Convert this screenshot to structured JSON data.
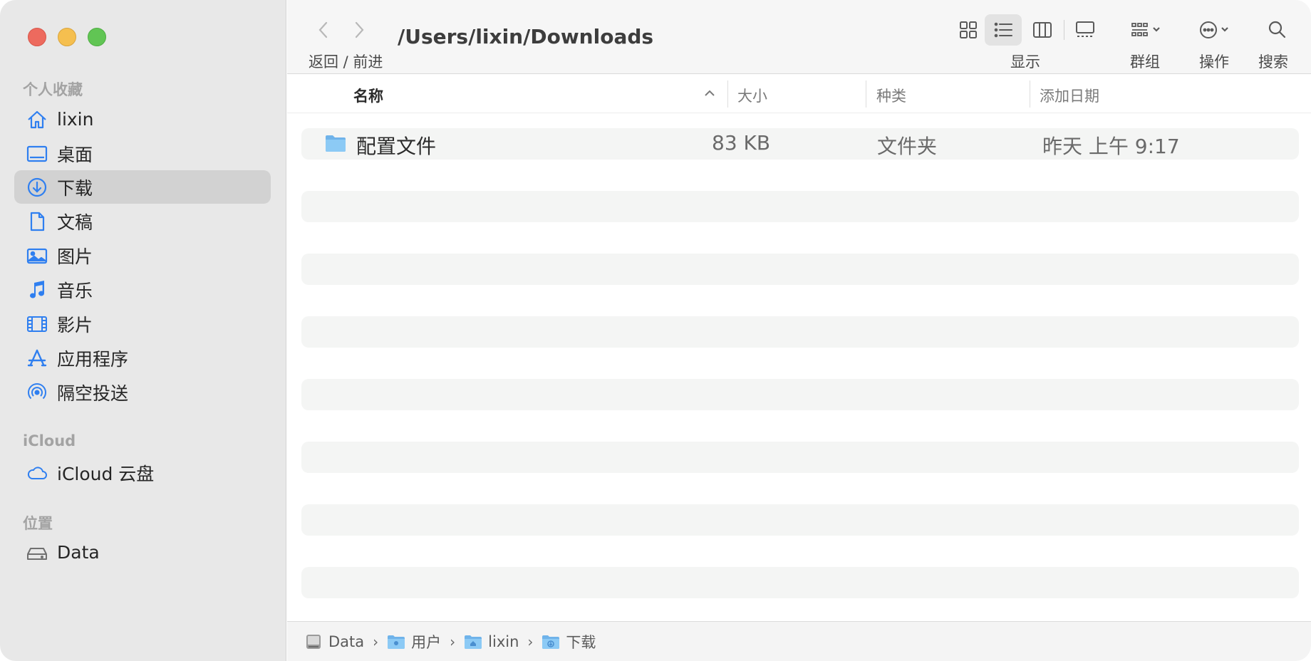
{
  "sidebar": {
    "favorites_title": "个人收藏",
    "favorites": [
      {
        "label": "lixin",
        "icon": "home-icon"
      },
      {
        "label": "桌面",
        "icon": "desktop-icon"
      },
      {
        "label": "下载",
        "icon": "download-icon",
        "selected": true
      },
      {
        "label": "文稿",
        "icon": "document-icon"
      },
      {
        "label": "图片",
        "icon": "photo-icon"
      },
      {
        "label": "音乐",
        "icon": "music-icon"
      },
      {
        "label": "影片",
        "icon": "film-icon"
      },
      {
        "label": "应用程序",
        "icon": "app-store-icon"
      },
      {
        "label": "隔空投送",
        "icon": "airdrop-icon"
      }
    ],
    "icloud_title": "iCloud",
    "icloud": [
      {
        "label": "iCloud 云盘",
        "icon": "cloud-icon"
      }
    ],
    "locations_title": "位置",
    "locations": [
      {
        "label": "Data",
        "icon": "drive-icon"
      }
    ]
  },
  "toolbar": {
    "nav_caption": "返回 / 前进",
    "path_title": "/Users/lixin/Downloads",
    "view_caption": "显示",
    "group_caption": "群组",
    "action_caption": "操作",
    "search_caption": "搜索"
  },
  "columns": {
    "name": "名称",
    "size": "大小",
    "kind": "种类",
    "date_added": "添加日期"
  },
  "files": [
    {
      "name": "配置文件",
      "size": "83 KB",
      "kind": "文件夹",
      "date_added": "昨天 上午 9:17",
      "icon": "folder-icon"
    }
  ],
  "pathbar": {
    "crumbs": [
      "Data",
      "用户",
      "lixin",
      "下载"
    ]
  },
  "colors": {
    "accent": "#2f7ff0",
    "close": "#ed6a5e",
    "minimize": "#f5bf4f",
    "maximize": "#61c554"
  }
}
